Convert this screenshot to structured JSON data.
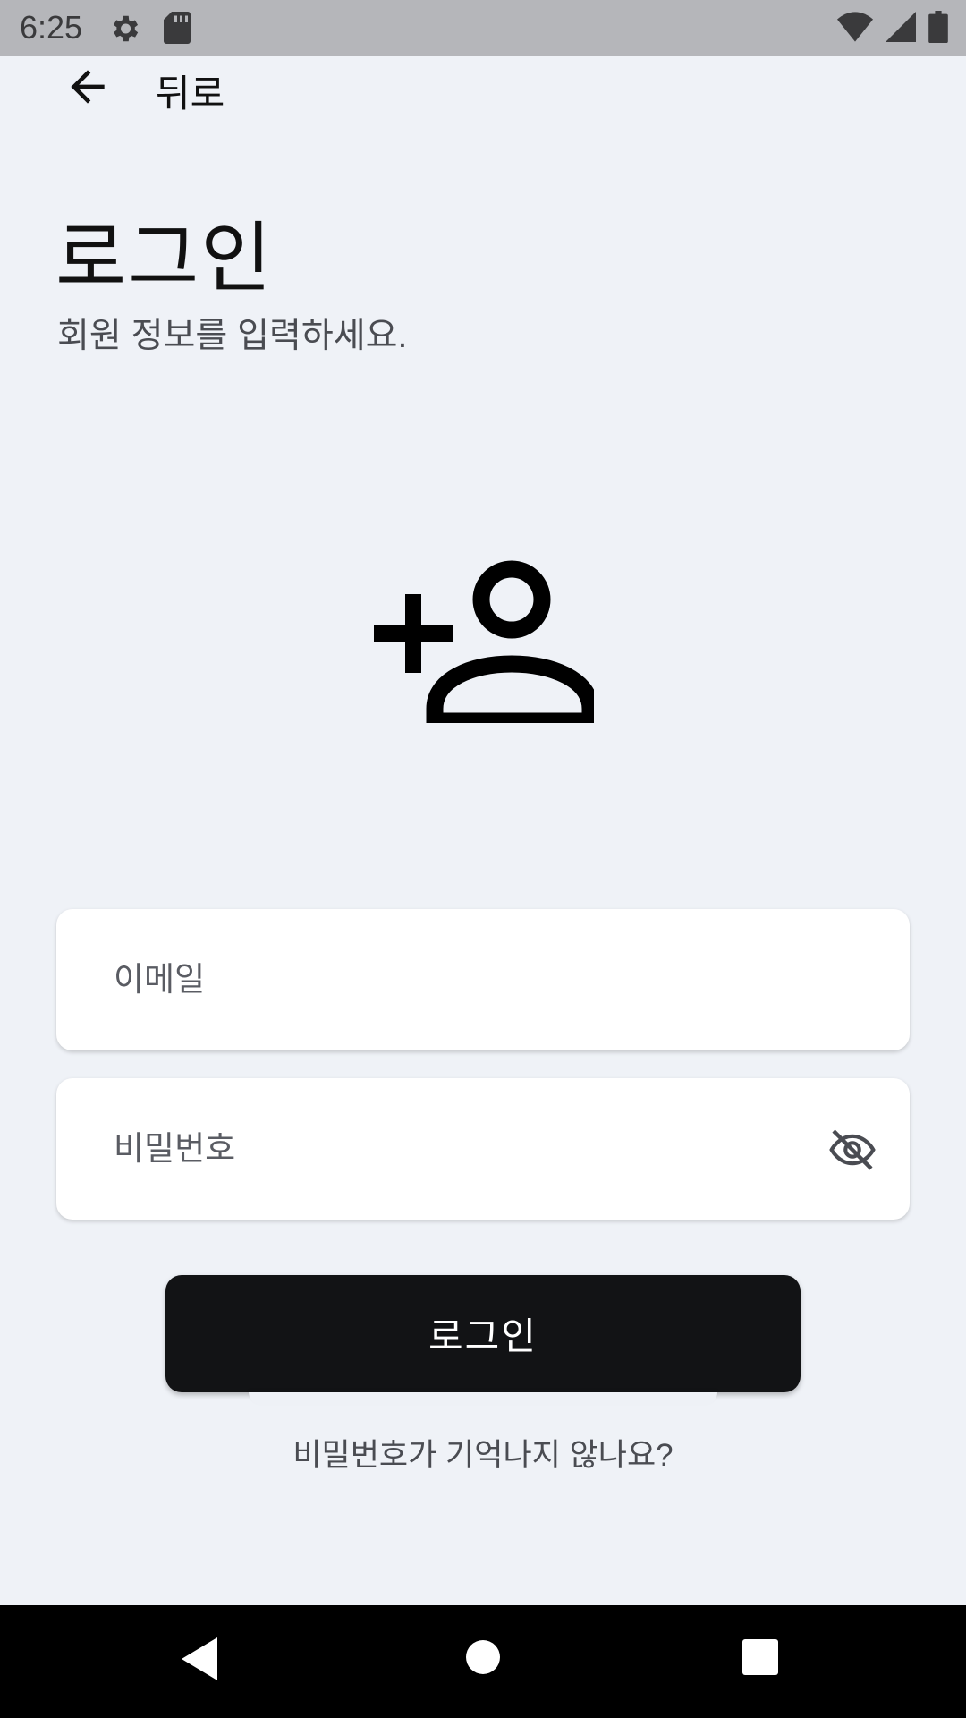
{
  "status_bar": {
    "time": "6:25",
    "icons": [
      "gear-icon",
      "sd-card-icon",
      "wifi-icon",
      "signal-icon",
      "battery-icon"
    ]
  },
  "topbar": {
    "back_label": "뒤로",
    "back_icon": "arrow-left-icon"
  },
  "header": {
    "title": "로그인",
    "subtitle": "회원 정보를 입력하세요."
  },
  "hero": {
    "icon": "add-person-icon"
  },
  "form": {
    "email_placeholder": "이메일",
    "email_value": "",
    "password_placeholder": "비밀번호",
    "password_value": "",
    "password_toggle_icon": "eye-off-icon",
    "login_label": "로그인",
    "forgot_label": "비밀번호가 기억나지 않나요?"
  },
  "nav_bar": {
    "icons": [
      "nav-back-icon",
      "nav-home-icon",
      "nav-recent-icon"
    ]
  },
  "colors": {
    "background": "#eff2f7",
    "button": "#121315",
    "status_bar": "#b5b6ba"
  }
}
